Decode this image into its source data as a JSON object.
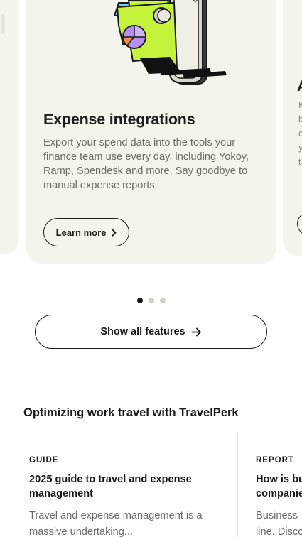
{
  "feature_card": {
    "title": "Expense integrations",
    "description": "Export your spend data into the tools your finance team use every day, including Yokoy, Ramp, Spendesk and more. Say goodbye to manual expense reports.",
    "cta_label": "Learn more",
    "illustration_icon": "phone-cards-illustration"
  },
  "next_card_peek": {
    "title_fragment": "A",
    "text_fragments": [
      "K",
      "b",
      "c",
      "y",
      "t"
    ]
  },
  "carousel": {
    "slide_count": 3,
    "active_index": 0
  },
  "show_all_label": "Show all features",
  "articles_section": {
    "title": "Optimizing work travel with TravelPerk",
    "articles": [
      {
        "tag": "GUIDE",
        "title": "2025 guide to travel and expense management",
        "description": "Travel and expense management is a massive undertaking..."
      },
      {
        "tag": "REPORT",
        "title": "How is bu companie",
        "description_lines": [
          "Business",
          "line. Disco"
        ]
      }
    ]
  },
  "colors": {
    "card_bg": "#f4f3ec",
    "accent_lime": "#c5f23a",
    "text_dark": "#1a1a1a",
    "text_muted": "#6b6b66"
  }
}
